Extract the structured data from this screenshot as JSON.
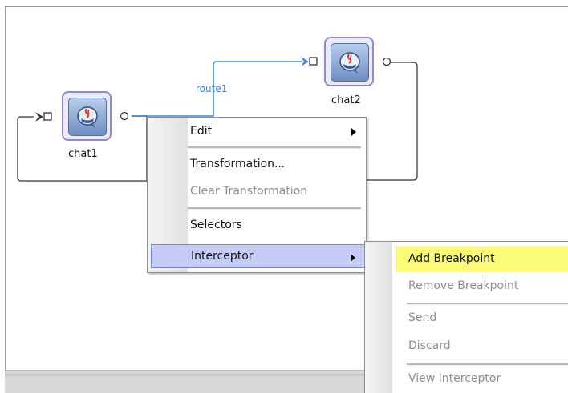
{
  "nodes": {
    "chat1": {
      "label": "chat1"
    },
    "chat2": {
      "label": "chat2"
    }
  },
  "route": {
    "label": "route1"
  },
  "context_menu": {
    "edit": "Edit",
    "transformation": "Transformation...",
    "clear_transformation": "Clear Transformation",
    "selectors": "Selectors",
    "interceptor": "Interceptor"
  },
  "interceptor_submenu": {
    "add_breakpoint": "Add Breakpoint",
    "remove_breakpoint": "Remove Breakpoint",
    "send": "Send",
    "discard": "Discard",
    "view_interceptor": "View Interceptor"
  },
  "colors": {
    "route_line": "#3a86e0",
    "node_border": "#8d8ad6",
    "menu_highlight": "#c5cdf6",
    "submenu_highlight": "#fbfb77"
  },
  "icons": {
    "node": "java-component-icon",
    "submenu_arrow": "triangle-right-icon"
  }
}
